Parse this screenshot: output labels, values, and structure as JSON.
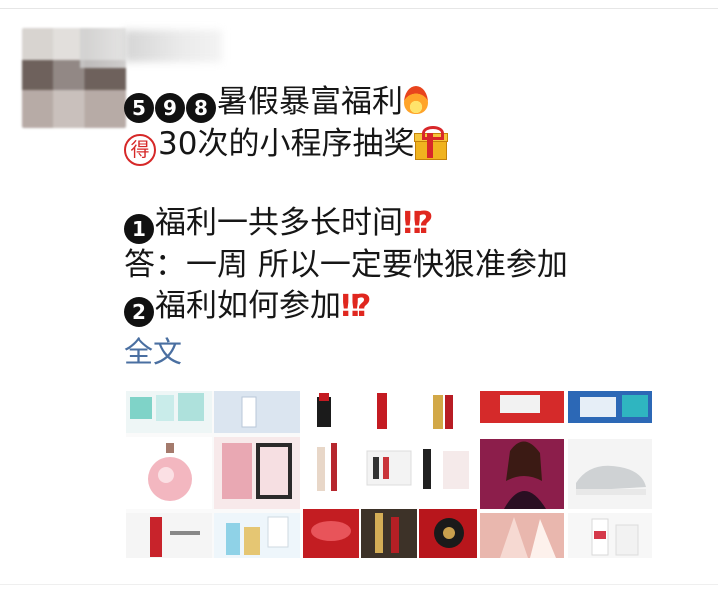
{
  "post": {
    "line1_nums": [
      "5",
      "9",
      "8"
    ],
    "line1_text": "暑假暴富福利",
    "line1_icon": "fire-icon",
    "line2_badge": "得",
    "line2_text": "30次的小程序抽奖",
    "line2_icon": "gift-icon",
    "line3_num": "1",
    "line3_text": "福利一共多长时间",
    "line4_text": "答：一周 所以一定要快狠准参加",
    "line5_num": "2",
    "line5_text": "福利如何参加",
    "mark": "‼",
    "mark2": "?"
  },
  "full_text_link": "全文",
  "colors": {
    "link": "#4a6fa1",
    "accent_red": "#d62828",
    "text": "#161616"
  },
  "grid_tiles": [
    {
      "name": "perfume-products"
    },
    {
      "name": "lipstick-products"
    },
    {
      "name": "mixed-products"
    }
  ]
}
